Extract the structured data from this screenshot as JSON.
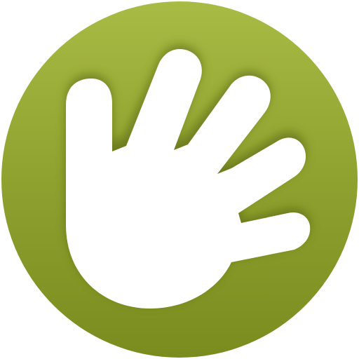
{
  "icon": {
    "name": "hand-wave-icon",
    "colors": {
      "disc_top": "#a8bb44",
      "disc_mid": "#8fa12f",
      "disc_bottom": "#7a8c1e",
      "hand_fill": "#ffffff",
      "inner_shadow": "#4d5c0a"
    }
  }
}
